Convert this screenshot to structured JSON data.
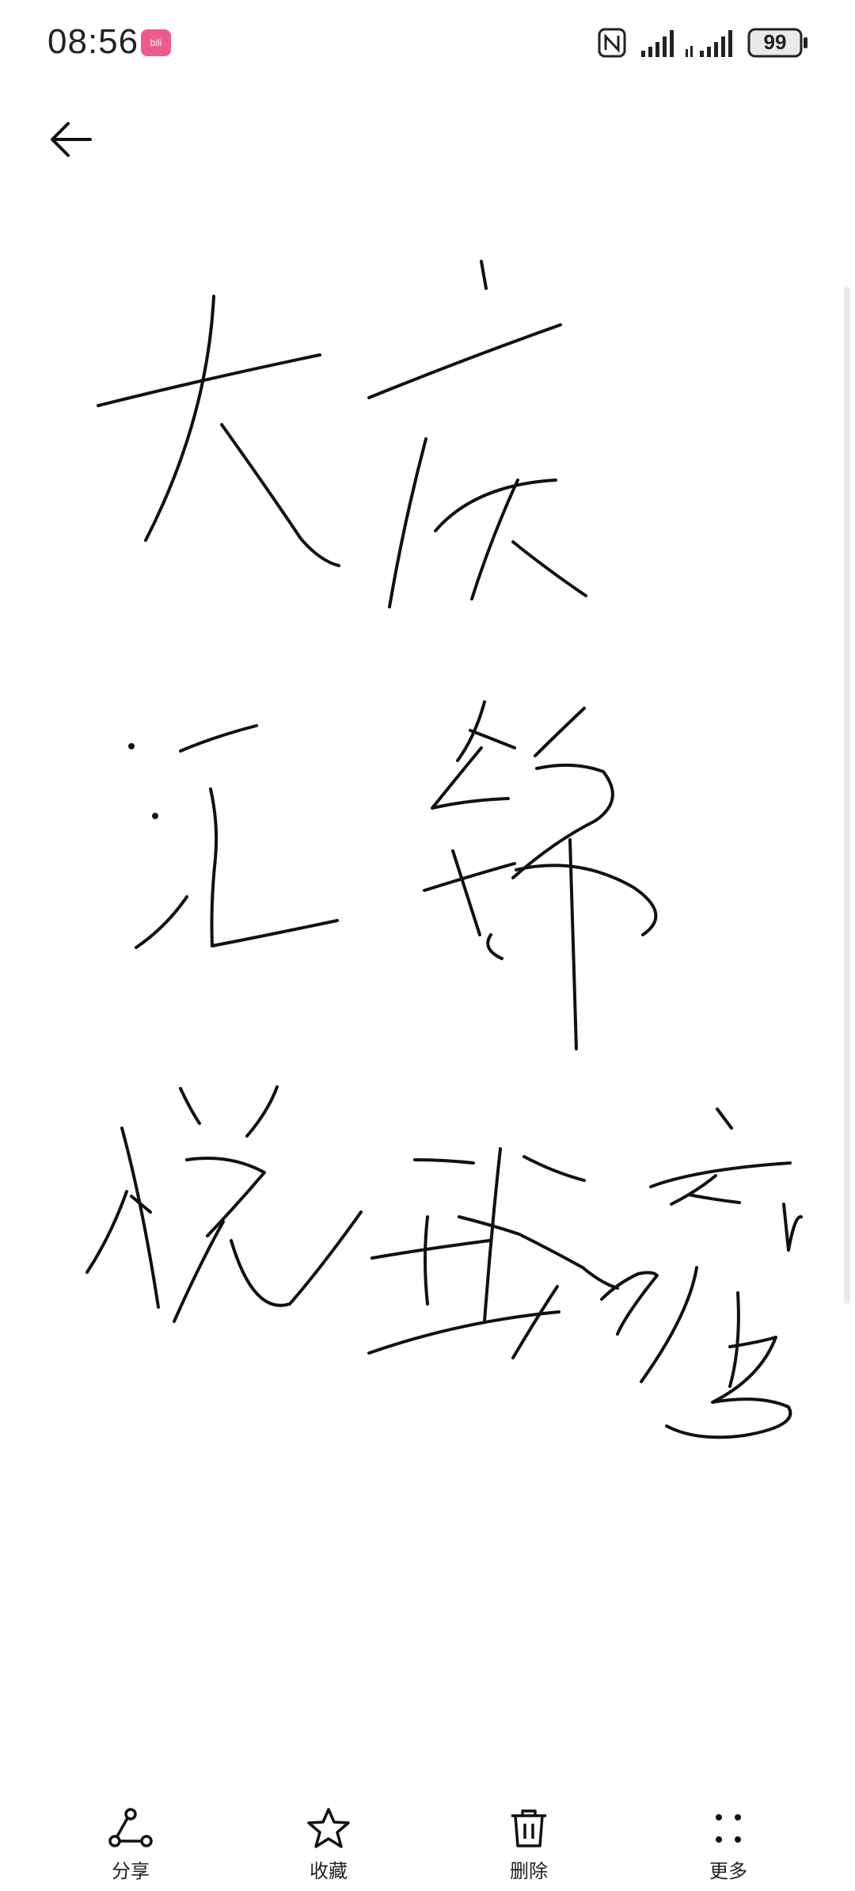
{
  "status_bar": {
    "time": "08:56",
    "battery": "99",
    "app_badge_icon": "pink-app-icon",
    "icons": [
      "nfc-icon",
      "signal-icon",
      "signal-icon",
      "battery-icon"
    ]
  },
  "header": {
    "back_icon": "arrow-left-icon"
  },
  "toolbar": {
    "share_label": "分享",
    "favorite_label": "收藏",
    "delete_label": "删除",
    "more_label": "更多"
  },
  "colors": {
    "ink": "#111111",
    "background": "#ffffff",
    "badge": "#ef5a8e"
  }
}
